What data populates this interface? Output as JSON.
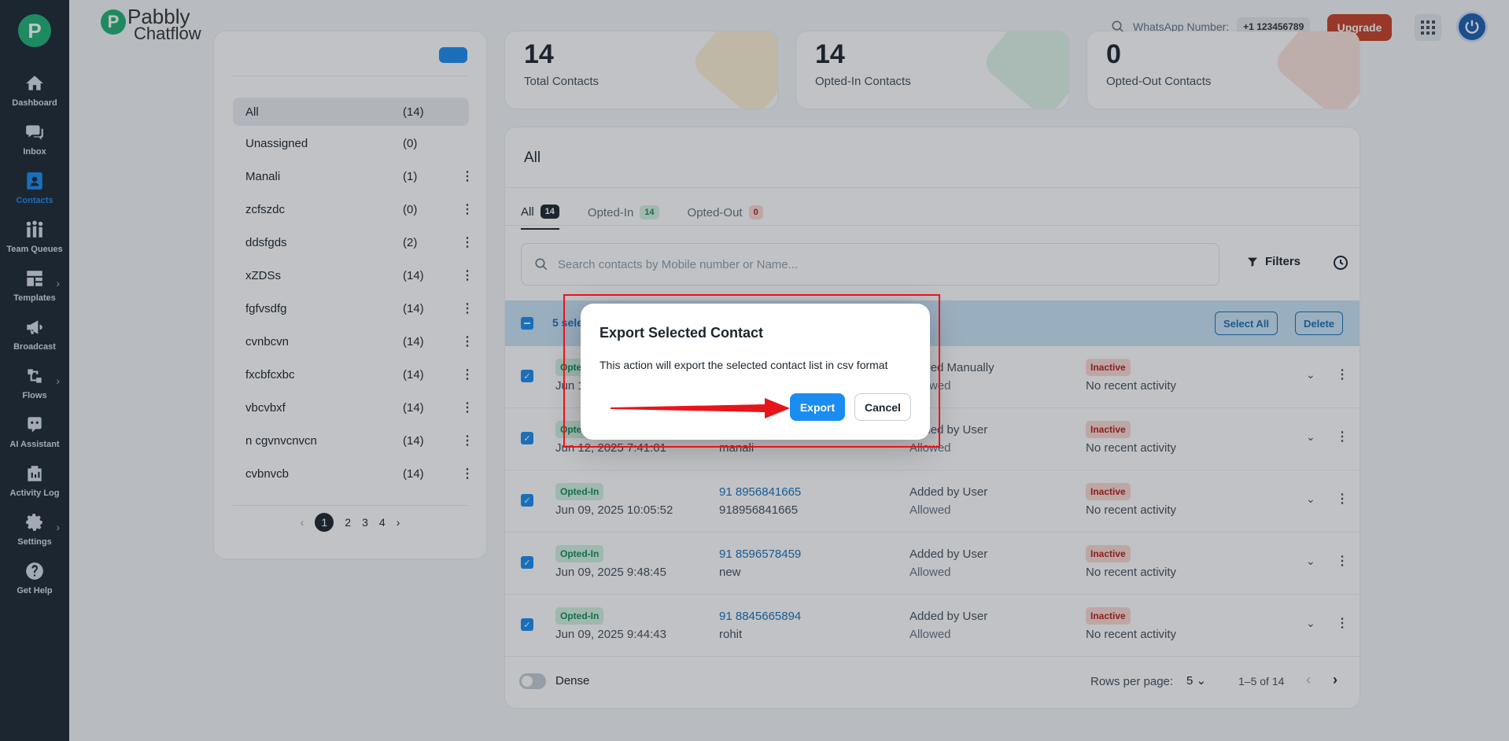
{
  "app": {
    "brand_line1": "Pabbly",
    "brand_line2": "Chatflow",
    "brand_initial": "P"
  },
  "sidebar": {
    "items": [
      {
        "label": "Dashboard",
        "icon": "home-icon"
      },
      {
        "label": "Inbox",
        "icon": "chat-icon"
      },
      {
        "label": "Contacts",
        "icon": "contacts-icon",
        "active": true
      },
      {
        "label": "Team Queues",
        "icon": "team-icon"
      },
      {
        "label": "Templates",
        "icon": "templates-icon"
      },
      {
        "label": "Broadcast",
        "icon": "megaphone-icon"
      },
      {
        "label": "Flows",
        "icon": "flows-icon"
      },
      {
        "label": "AI Assistant",
        "icon": "ai-icon"
      },
      {
        "label": "Activity Log",
        "icon": "activity-icon"
      },
      {
        "label": "Settings",
        "icon": "gear-icon"
      },
      {
        "label": "Get Help",
        "icon": "help-icon"
      }
    ]
  },
  "header": {
    "whatsapp_label": "WhatsApp Number:",
    "whatsapp_number": "+1 123456789",
    "upgrade_label": "Upgrade"
  },
  "lists": {
    "items": [
      {
        "name": "All",
        "count": "(14)"
      },
      {
        "name": "Unassigned",
        "count": "(0)"
      },
      {
        "name": "Manali",
        "count": "(1)"
      },
      {
        "name": "zcfszdc",
        "count": "(0)"
      },
      {
        "name": "ddsfgds",
        "count": "(2)"
      },
      {
        "name": "xZDSs",
        "count": "(14)"
      },
      {
        "name": "fgfvsdfg",
        "count": "(14)"
      },
      {
        "name": "cvnbcvn",
        "count": "(14)"
      },
      {
        "name": "fxcbfcxbc",
        "count": "(14)"
      },
      {
        "name": "vbcvbxf",
        "count": "(14)"
      },
      {
        "name": "n cgvnvcnvcn",
        "count": "(14)"
      },
      {
        "name": "cvbnvcb",
        "count": "(14)"
      }
    ],
    "pages": [
      "1",
      "2",
      "3",
      "4"
    ],
    "prev": "‹",
    "next": "›"
  },
  "stats": [
    {
      "number": "14",
      "label": "Total Contacts"
    },
    {
      "number": "14",
      "label": "Opted-In Contacts"
    },
    {
      "number": "0",
      "label": "Opted-Out Contacts"
    }
  ],
  "table": {
    "title": "All",
    "tabs": [
      {
        "label": "All",
        "count": "14"
      },
      {
        "label": "Opted-In",
        "count": "14"
      },
      {
        "label": "Opted-Out",
        "count": "0"
      }
    ],
    "search_placeholder": "Search contacts by Mobile number or Name...",
    "filters_label": "Filters",
    "selected_text": "5 selected",
    "select_all_label": "Select All",
    "delete_label": "Delete",
    "rows": [
      {
        "status": "Opted-In",
        "date": "Jun 12, 2025 7:41:01",
        "phone": "",
        "name": "",
        "added": "Added Manually",
        "allowed": "Allowed",
        "state": "Inactive",
        "activity": "No recent activity"
      },
      {
        "status": "Opted-In",
        "date": "Jun 12, 2025 7:41:01",
        "phone": "",
        "name": "manali",
        "added": "Added by User",
        "allowed": "Allowed",
        "state": "Inactive",
        "activity": "No recent activity"
      },
      {
        "status": "Opted-In",
        "date": "Jun 09, 2025 10:05:52",
        "phone": "91 8956841665",
        "name": "918956841665",
        "added": "Added by User",
        "allowed": "Allowed",
        "state": "Inactive",
        "activity": "No recent activity"
      },
      {
        "status": "Opted-In",
        "date": "Jun 09, 2025 9:48:45",
        "phone": "91 8596578459",
        "name": "new",
        "added": "Added by User",
        "allowed": "Allowed",
        "state": "Inactive",
        "activity": "No recent activity"
      },
      {
        "status": "Opted-In",
        "date": "Jun 09, 2025 9:44:43",
        "phone": "91 8845665894",
        "name": "rohit",
        "added": "Added by User",
        "allowed": "Allowed",
        "state": "Inactive",
        "activity": "No recent activity"
      }
    ],
    "dense_label": "Dense",
    "rows_per_page_label": "Rows per page:",
    "rows_per_page_value": "5",
    "range_text": "1–5 of 14"
  },
  "modal": {
    "title": "Export Selected Contact",
    "text": "This action will export the selected contact list in csv format",
    "export_label": "Export",
    "cancel_label": "Cancel"
  },
  "colors": {
    "sidebar_bg": "#1d2733",
    "accent": "#1b8cf0",
    "upgrade": "#c84126",
    "annotation": "#e8141b"
  }
}
